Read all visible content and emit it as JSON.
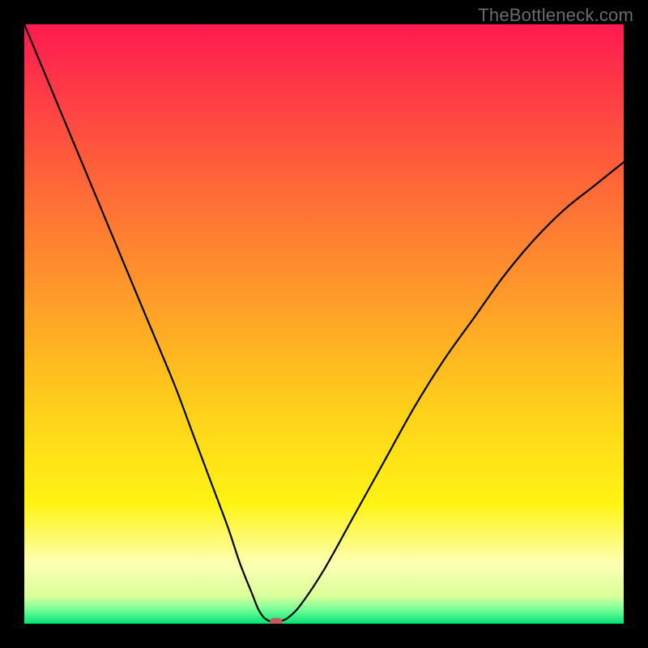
{
  "watermark": {
    "text": "TheBottleneck.com"
  },
  "chart_data": {
    "type": "line",
    "title": "",
    "xlabel": "",
    "ylabel": "",
    "xlim": [
      0,
      100
    ],
    "ylim": [
      0,
      100
    ],
    "grid": false,
    "plot_background_gradient": {
      "direction": "vertical",
      "stops": [
        {
          "pos": 0.0,
          "color": "#ff1a50"
        },
        {
          "pos": 0.22,
          "color": "#ff5a3c"
        },
        {
          "pos": 0.45,
          "color": "#ff9a2a"
        },
        {
          "pos": 0.65,
          "color": "#ffd21a"
        },
        {
          "pos": 0.8,
          "color": "#fff314"
        },
        {
          "pos": 0.9,
          "color": "#fdffb3"
        },
        {
          "pos": 0.955,
          "color": "#d8ff9a"
        },
        {
          "pos": 0.975,
          "color": "#7dff99"
        },
        {
          "pos": 1.0,
          "color": "#00e574"
        }
      ]
    },
    "series": [
      {
        "name": "bottleneck-curve",
        "color": "#000000",
        "x": [
          0,
          5,
          10,
          15,
          20,
          25,
          28,
          31,
          34,
          36,
          38,
          39,
          40,
          41,
          42,
          43,
          44,
          46,
          50,
          55,
          60,
          65,
          70,
          75,
          80,
          85,
          90,
          95,
          100
        ],
        "y": [
          100,
          88,
          76,
          64,
          52,
          40,
          32,
          24,
          16,
          10,
          5,
          2.5,
          1,
          0.4,
          0.2,
          0.5,
          1,
          3,
          9,
          18,
          27,
          36,
          44,
          51,
          58,
          64,
          69,
          73,
          77
        ]
      }
    ],
    "marker": {
      "x": 42,
      "y": 0.3,
      "color": "#c75a5a",
      "name": "optimal-point"
    }
  }
}
